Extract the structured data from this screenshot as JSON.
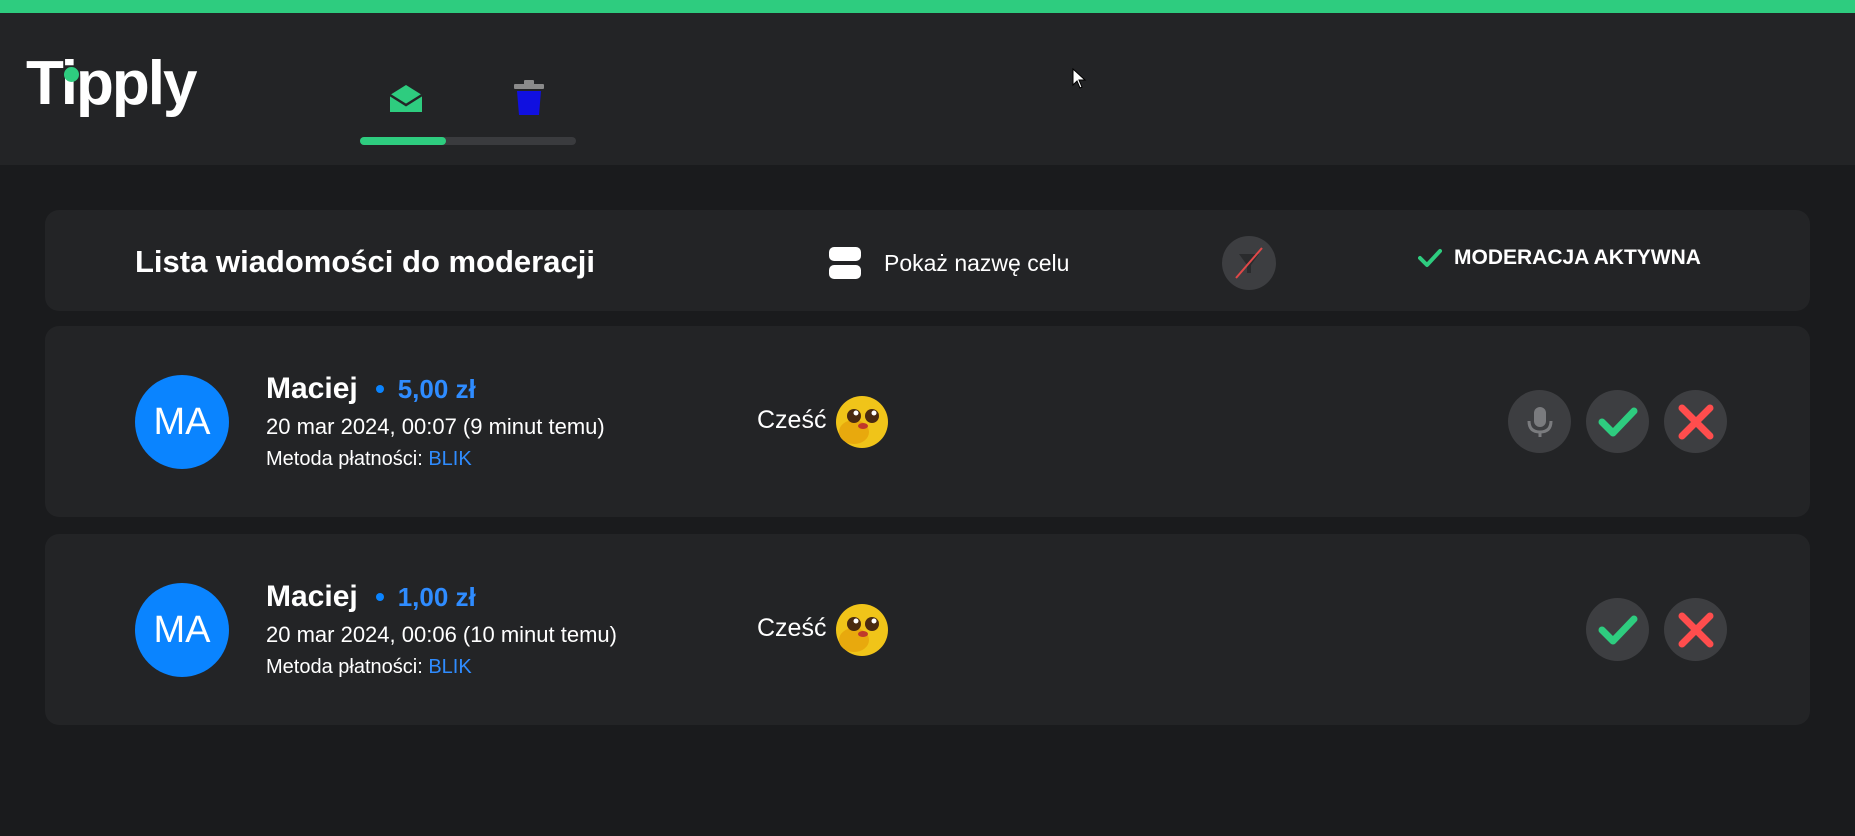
{
  "app": {
    "logo_text": "Tipply",
    "accent_color": "#2ecc7f",
    "tabs": [
      {
        "icon": "envelope-open-icon",
        "active": true
      },
      {
        "icon": "trash-icon",
        "active": false
      }
    ]
  },
  "toolbar": {
    "title": "Lista wiadomości do moderacji",
    "show_goal_label": "Pokaż nazwę celu",
    "moderation_status": "MODERACJA AKTYWNA"
  },
  "messages": [
    {
      "initials": "MA",
      "sender": "Maciej",
      "amount": "5,00 zł",
      "datetime": "20 mar 2024, 00:07 (9 minut temu)",
      "payment_label": "Metoda płatności:",
      "payment_method": "BLIK",
      "text": "Cześć",
      "has_voice": true
    },
    {
      "initials": "MA",
      "sender": "Maciej",
      "amount": "1,00 zł",
      "datetime": "20 mar 2024, 00:06 (10 minut temu)",
      "payment_label": "Metoda płatności:",
      "payment_method": "BLIK",
      "text": "Cześć",
      "has_voice": false
    }
  ]
}
